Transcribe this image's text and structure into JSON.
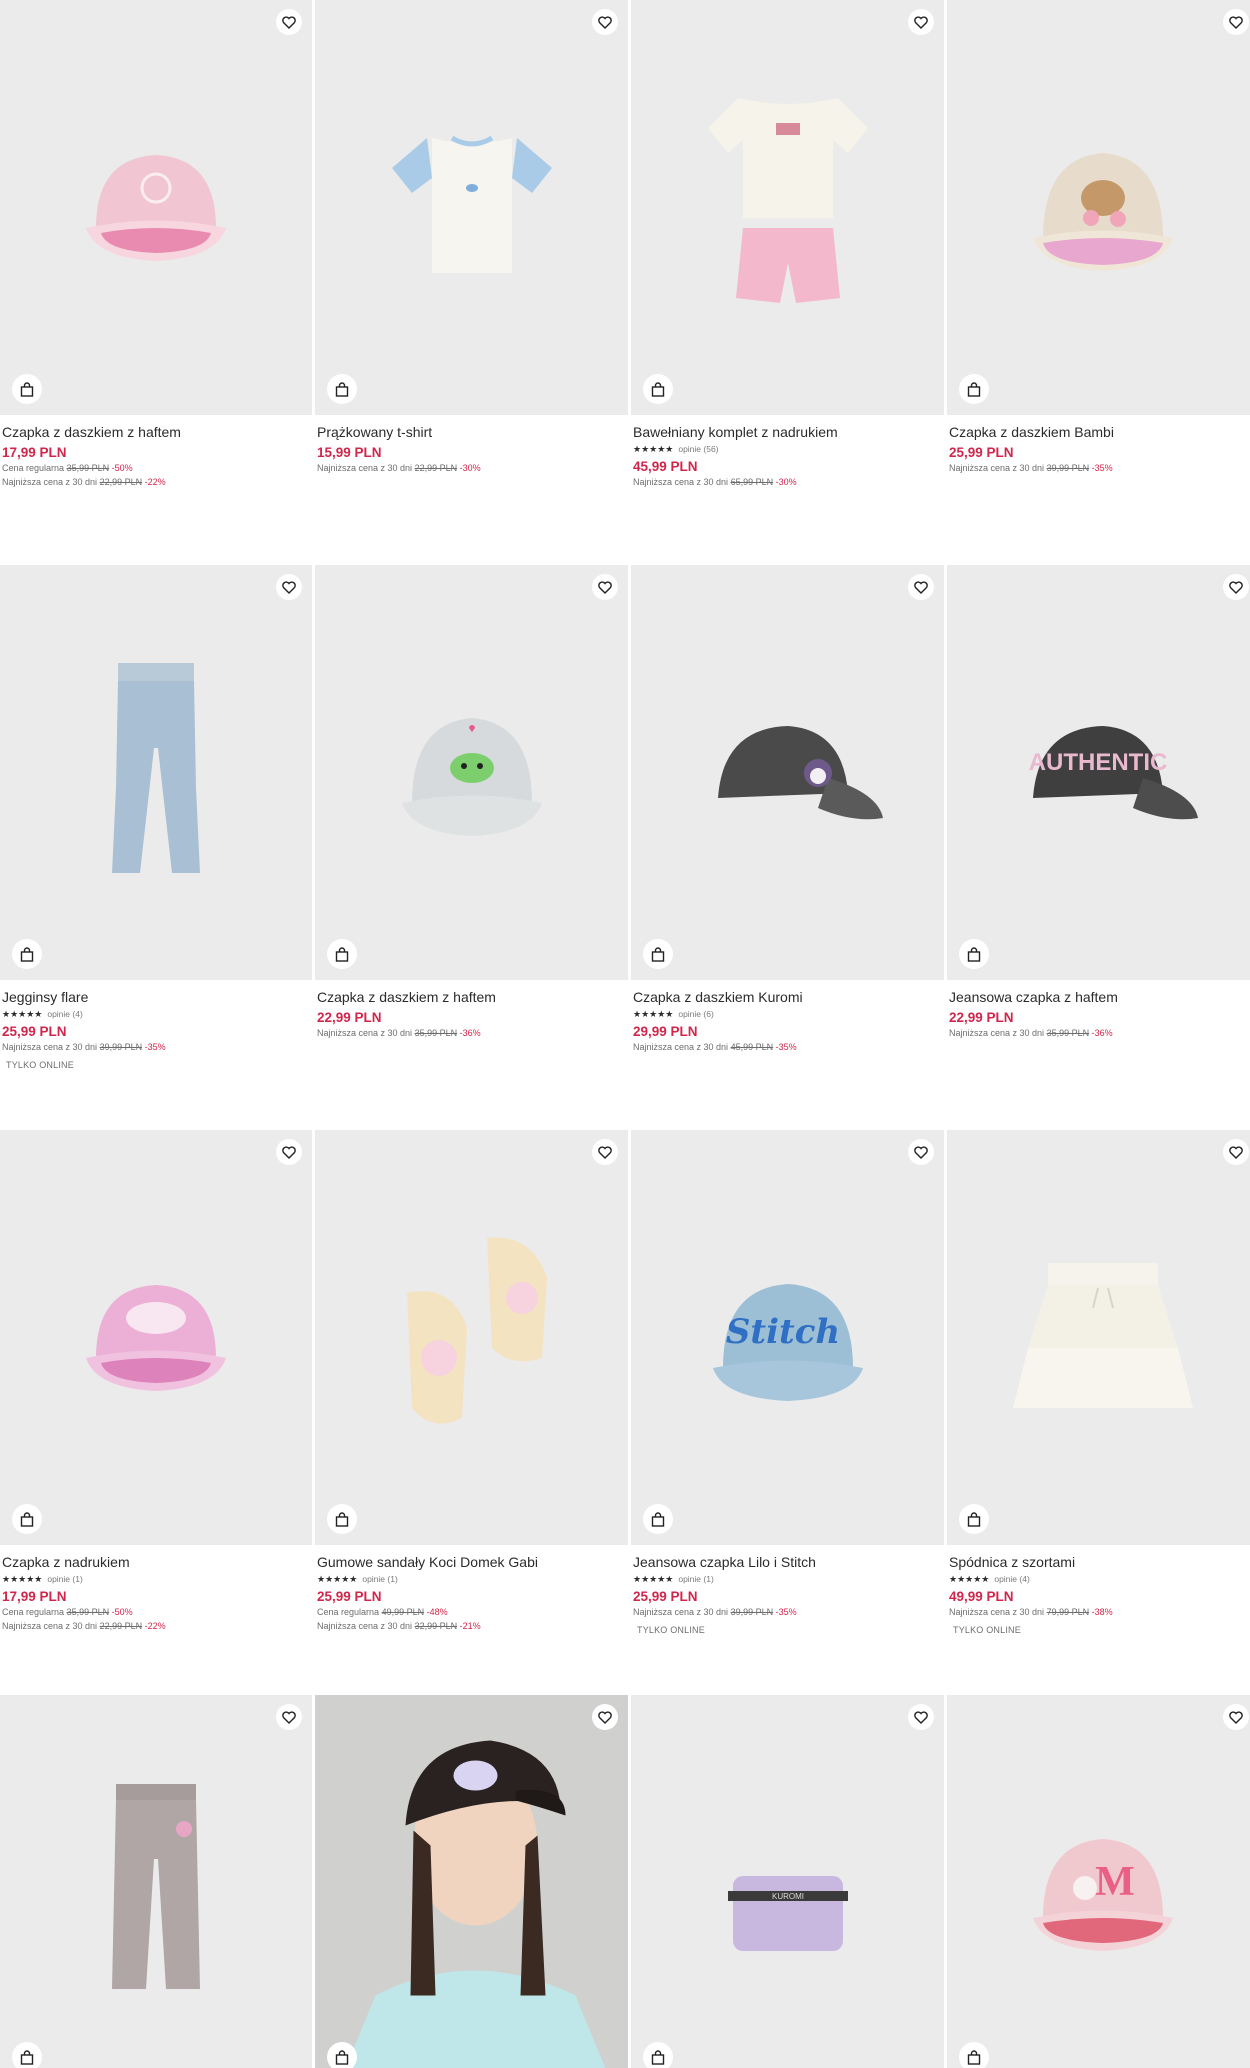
{
  "products": [
    {
      "name": "Czapka z daszkiem z haftem",
      "price": "17,99 PLN",
      "regular": {
        "label": "Cena regularna",
        "old": "35,99 PLN",
        "disc": "-50%"
      },
      "lowest": {
        "label": "Najniższa cena z 30 dni",
        "old": "22,99 PLN",
        "disc": "-22%"
      }
    },
    {
      "name": "Prążkowany t-shirt",
      "price": "15,99 PLN",
      "lowest": {
        "label": "Najniższa cena z 30 dni",
        "old": "22,99 PLN",
        "disc": "-30%"
      }
    },
    {
      "name": "Bawełniany komplet z nadrukiem",
      "stars": "★★★★★",
      "reviews": "opinie (56)",
      "price": "45,99 PLN",
      "lowest": {
        "label": "Najniższa cena z 30 dni",
        "old": "65,99 PLN",
        "disc": "-30%"
      }
    },
    {
      "name": "Czapka z daszkiem Bambi",
      "price": "25,99 PLN",
      "lowest": {
        "label": "Najniższa cena z 30 dni",
        "old": "39,99 PLN",
        "disc": "-35%"
      }
    },
    {
      "name": "Jegginsy flare",
      "stars": "★★★★★",
      "reviews": "opinie (4)",
      "price": "25,99 PLN",
      "lowest": {
        "label": "Najniższa cena z 30 dni",
        "old": "39,99 PLN",
        "disc": "-35%"
      },
      "badge": "TYLKO ONLINE"
    },
    {
      "name": "Czapka z daszkiem z haftem",
      "price": "22,99 PLN",
      "lowest": {
        "label": "Najniższa cena z 30 dni",
        "old": "35,99 PLN",
        "disc": "-36%"
      }
    },
    {
      "name": "Czapka z daszkiem Kuromi",
      "stars": "★★★★★",
      "reviews": "opinie (6)",
      "price": "29,99 PLN",
      "lowest": {
        "label": "Najniższa cena z 30 dni",
        "old": "45,99 PLN",
        "disc": "-35%"
      }
    },
    {
      "name": "Jeansowa czapka z haftem",
      "price": "22,99 PLN",
      "lowest": {
        "label": "Najniższa cena z 30 dni",
        "old": "35,99 PLN",
        "disc": "-36%"
      }
    },
    {
      "name": "Czapka z nadrukiem",
      "stars": "★★★★★",
      "reviews": "opinie (1)",
      "price": "17,99 PLN",
      "regular": {
        "label": "Cena regularna",
        "old": "35,99 PLN",
        "disc": "-50%"
      },
      "lowest": {
        "label": "Najniższa cena z 30 dni",
        "old": "22,99 PLN",
        "disc": "-22%"
      }
    },
    {
      "name": "Gumowe sandały Koci Domek Gabi",
      "stars": "★★★★★",
      "reviews": "opinie (1)",
      "price": "25,99 PLN",
      "regular": {
        "label": "Cena regularna",
        "old": "49,99 PLN",
        "disc": "-48%"
      },
      "lowest": {
        "label": "Najniższa cena z 30 dni",
        "old": "32,99 PLN",
        "disc": "-21%"
      }
    },
    {
      "name": "Jeansowa czapka Lilo i Stitch",
      "stars": "★★★★★",
      "reviews": "opinie (1)",
      "price": "25,99 PLN",
      "lowest": {
        "label": "Najniższa cena z 30 dni",
        "old": "39,99 PLN",
        "disc": "-35%"
      },
      "badge": "TYLKO ONLINE"
    },
    {
      "name": "Spódnica z szortami",
      "stars": "★★★★★",
      "reviews": "opinie (4)",
      "price": "49,99 PLN",
      "lowest": {
        "label": "Najniższa cena z 30 dni",
        "old": "79,99 PLN",
        "disc": "-38%"
      },
      "badge": "TYLKO ONLINE"
    }
  ],
  "artwork_text": {
    "bambi_cap": "",
    "authentic_cap": "AUTHENTIC",
    "stitch_cap": "Stitch",
    "kuromi_pouch": "KUROMI",
    "melody_cap": "M"
  },
  "colors": {
    "price": "#d1264c",
    "image_bg": "#ebebeb"
  }
}
